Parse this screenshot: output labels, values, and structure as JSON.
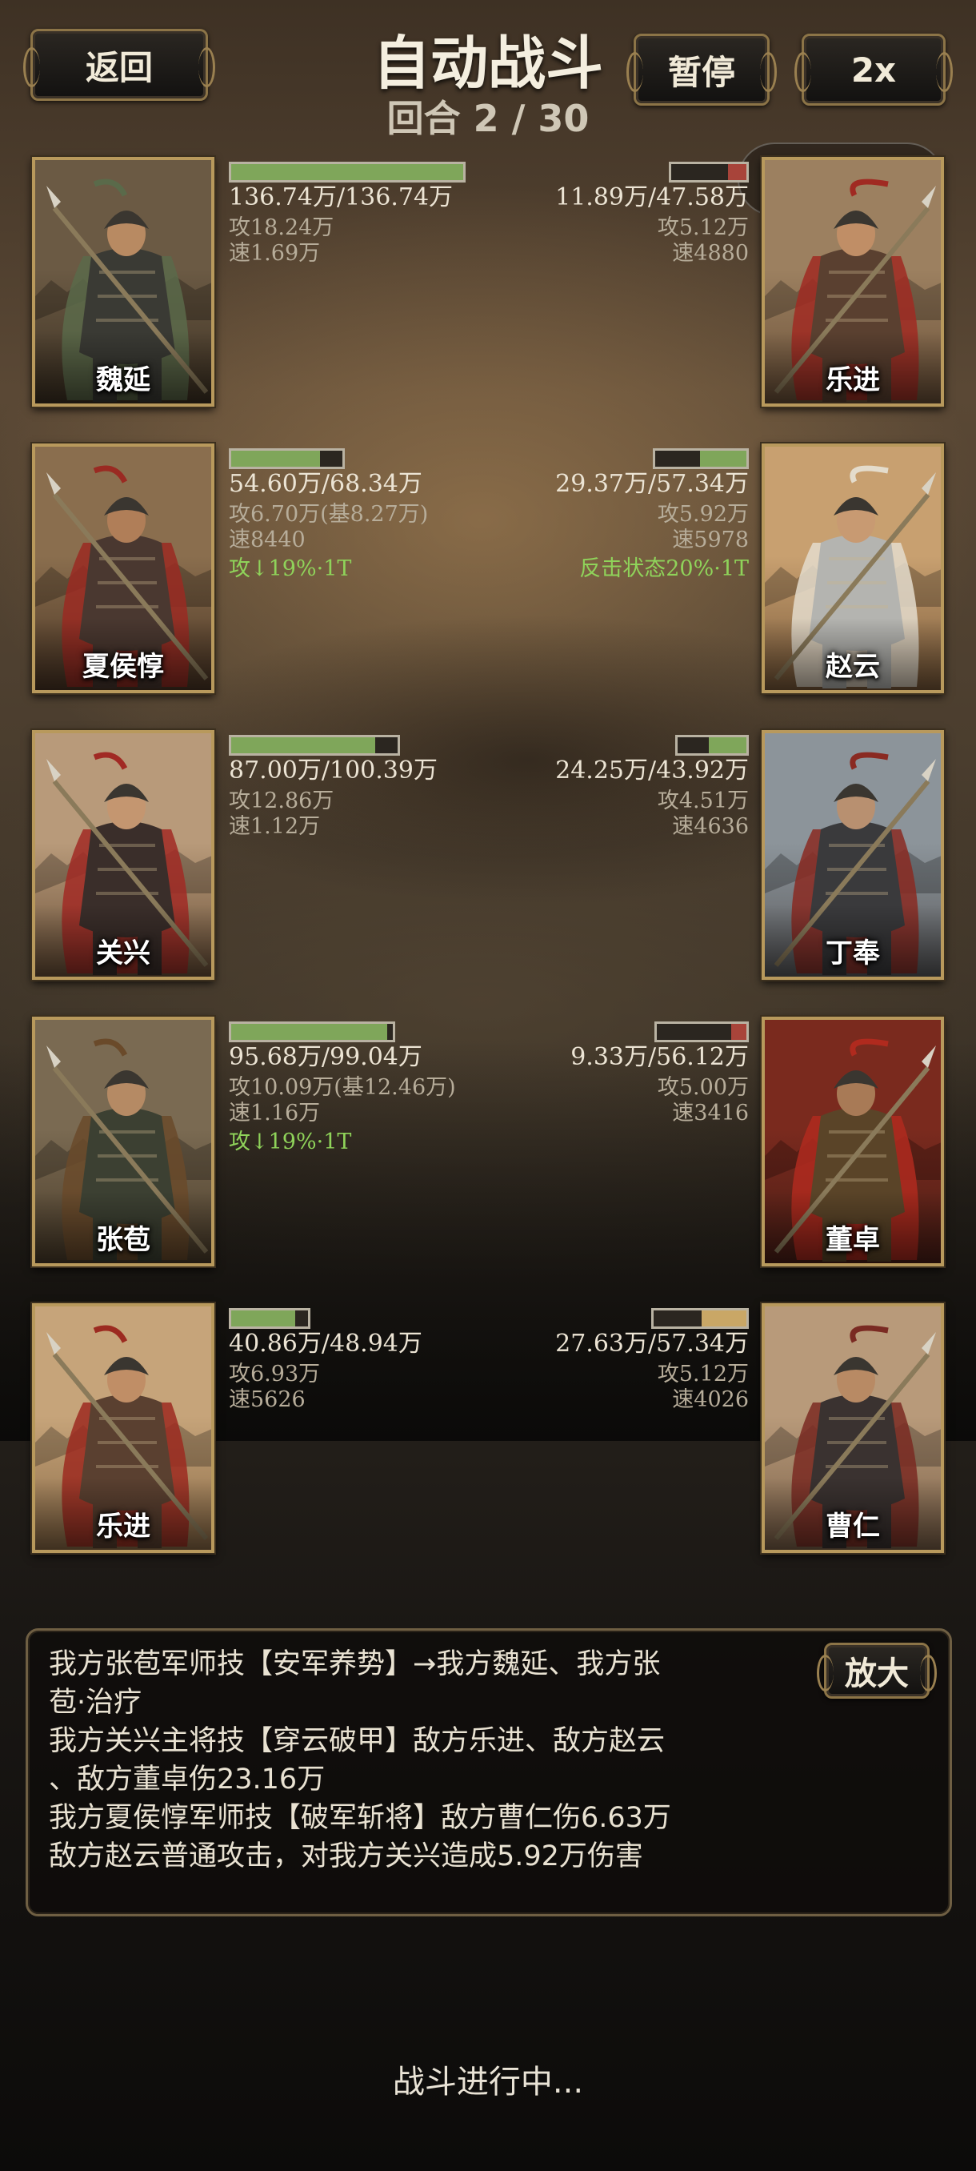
{
  "header": {
    "back_label": "返回",
    "title": "自动战斗",
    "round_text": "回合 2 / 30",
    "pause_label": "暂停",
    "speed_label": "2x"
  },
  "capsule": {
    "more_glyph": "•••"
  },
  "allies": [
    {
      "name": "魏延",
      "hp_text": "136.74万/136.74万",
      "atk": "攻18.24万",
      "spd": "速1.69万",
      "buff": "",
      "hp_ratio": 1.0,
      "hp_color": "#7fa65a",
      "portrait": {
        "sky": "#6b5a44",
        "ground": "#3c3022",
        "armor": "#3a3a34",
        "accent": "#5a6a4a",
        "skin": "#b88a62"
      }
    },
    {
      "name": "夏侯惇",
      "hp_text": "54.60万/68.34万",
      "atk": "攻6.70万(基8.27万)",
      "spd": "速8440",
      "buff": "攻↓19%·1T",
      "hp_ratio": 0.8,
      "hp_color": "#7fa65a",
      "portrait": {
        "sky": "#8a6e4e",
        "ground": "#4a3524",
        "armor": "#4a3830",
        "accent": "#9a2a22",
        "skin": "#b07e58"
      }
    },
    {
      "name": "关兴",
      "hp_text": "87.00万/100.39万",
      "atk": "攻12.86万",
      "spd": "速1.12万",
      "buff": "",
      "hp_ratio": 0.867,
      "hp_color": "#7fa65a",
      "portrait": {
        "sky": "#b89a7a",
        "ground": "#6a5038",
        "armor": "#3a2e2a",
        "accent": "#a12a24",
        "skin": "#c49670"
      }
    },
    {
      "name": "张苞",
      "hp_text": "95.68万/99.04万",
      "atk": "攻10.09万(基12.46万)",
      "spd": "速1.16万",
      "buff": "攻↓19%·1T",
      "hp_ratio": 0.966,
      "hp_color": "#7fa65a",
      "portrait": {
        "sky": "#7a6a52",
        "ground": "#4a3c2a",
        "armor": "#3c4032",
        "accent": "#6a4a2a",
        "skin": "#b58a64"
      }
    },
    {
      "name": "乐进",
      "hp_text": "40.86万/48.94万",
      "atk": "攻6.93万",
      "spd": "速5626",
      "buff": "",
      "hp_ratio": 0.835,
      "hp_color": "#7fa65a",
      "portrait": {
        "sky": "#c6a47a",
        "ground": "#8a6a46",
        "armor": "#5a4030",
        "accent": "#9c2a20",
        "skin": "#c08e66"
      }
    }
  ],
  "enemies": [
    {
      "name": "乐进",
      "hp_text": "11.89万/47.58万",
      "atk": "攻5.12万",
      "spd": "速4880",
      "buff": "",
      "hp_ratio": 0.25,
      "hp_color": "#a8443a",
      "portrait": {
        "sky": "#9c8060",
        "ground": "#6a5038",
        "armor": "#5a4030",
        "accent": "#a02a22",
        "skin": "#c08e66"
      }
    },
    {
      "name": "赵云",
      "hp_text": "29.37万/57.34万",
      "atk": "攻5.92万",
      "spd": "速5978",
      "buff": "反击状态20%·1T",
      "hp_ratio": 0.512,
      "hp_color": "#7fa65a",
      "portrait": {
        "sky": "#c8a070",
        "ground": "#7a5a3a",
        "armor": "#b4b4b0",
        "accent": "#e4dccc",
        "skin": "#c89a72"
      }
    },
    {
      "name": "丁奉",
      "hp_text": "24.25万/43.92万",
      "atk": "攻4.51万",
      "spd": "速4636",
      "buff": "",
      "hp_ratio": 0.552,
      "hp_color": "#7fa65a",
      "portrait": {
        "sky": "#8c949a",
        "ground": "#5a5a5c",
        "armor": "#3a3a3c",
        "accent": "#8a2a22",
        "skin": "#b89070"
      }
    },
    {
      "name": "董卓",
      "hp_text": "9.33万/56.12万",
      "atk": "攻5.00万",
      "spd": "速3416",
      "buff": "",
      "hp_ratio": 0.166,
      "hp_color": "#a8443a",
      "portrait": {
        "sky": "#7a2a1e",
        "ground": "#4a1e16",
        "armor": "#5a4428",
        "accent": "#b02a1e",
        "skin": "#a87a56"
      }
    },
    {
      "name": "曹仁",
      "hp_text": "27.63万/57.34万",
      "atk": "攻5.12万",
      "spd": "速4026",
      "buff": "",
      "hp_ratio": 0.482,
      "hp_color": "#c9a766",
      "portrait": {
        "sky": "#b89a7a",
        "ground": "#7a6048",
        "armor": "#3a3230",
        "accent": "#7a2a22",
        "skin": "#b88a64"
      }
    }
  ],
  "log": {
    "zoom_label": "放大",
    "lines": [
      "我方张苞军师技【安军养势】→我方魏延、我方张",
      "苞·治疗",
      "我方关兴主将技【穿云破甲】敌方乐进、敌方赵云",
      "、敌方董卓伤23.16万",
      "我方夏侯惇军师技【破军斩将】敌方曹仁伤6.63万",
      "敌方赵云普通攻击，对我方关兴造成5.92万伤害"
    ]
  },
  "status": "战斗进行中..."
}
